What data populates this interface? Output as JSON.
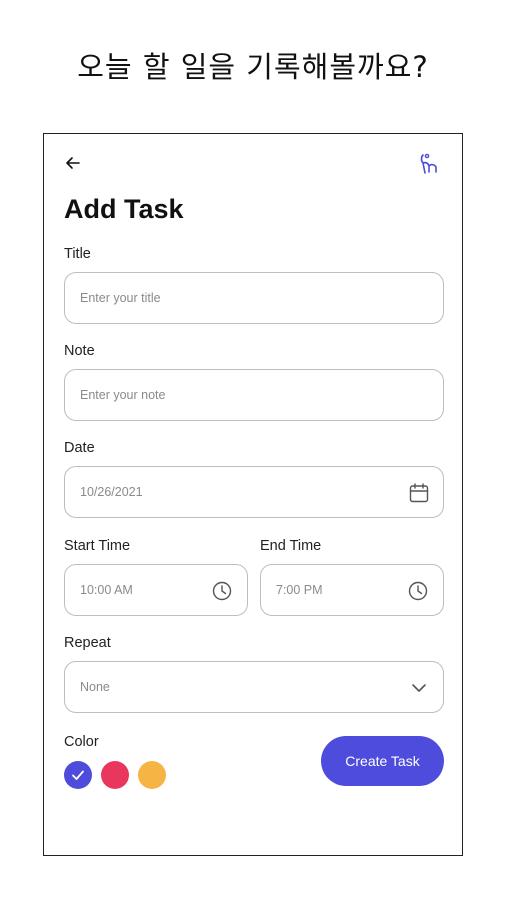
{
  "headline": "오늘 할 일을 기록해볼까요?",
  "header": {
    "back_icon": "arrow-left-icon",
    "profile_icon": "profile-icon"
  },
  "page_title": "Add Task",
  "form": {
    "title": {
      "label": "Title",
      "placeholder": "Enter your title"
    },
    "note": {
      "label": "Note",
      "placeholder": "Enter your note"
    },
    "date": {
      "label": "Date",
      "value": "10/26/2021",
      "icon": "calendar-icon"
    },
    "start_time": {
      "label": "Start Time",
      "value": "10:00 AM",
      "icon": "clock-icon"
    },
    "end_time": {
      "label": "End Time",
      "value": "7:00 PM",
      "icon": "clock-icon"
    },
    "repeat": {
      "label": "Repeat",
      "value": "None",
      "icon": "chevron-down-icon"
    },
    "color": {
      "label": "Color",
      "options": [
        "#4e4cdc",
        "#e9365c",
        "#f6b445"
      ],
      "selected_index": 0
    }
  },
  "create_button": {
    "label": "Create Task",
    "color": "#4e4cdc"
  },
  "colors": {
    "accent": "#4e4cdc",
    "border": "#bdbdbd"
  }
}
